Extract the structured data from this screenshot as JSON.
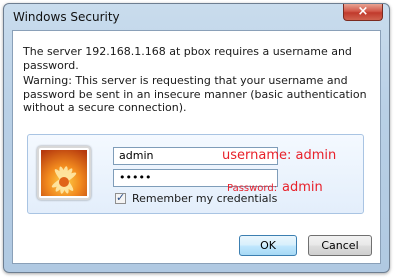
{
  "window": {
    "title": "Windows Security",
    "close_label": "×"
  },
  "message": {
    "server_line": "The server 192.168.1.168 at pbox requires a username and password.",
    "warning": "Warning: This server is requesting that your username and password be sent in an insecure manner (basic authentication without a secure connection)."
  },
  "credentials": {
    "username_value": "admin",
    "password_value": "•••••",
    "remember_label": "Remember my credentials",
    "remember_checked": true,
    "remember_mark": "✓"
  },
  "annotations": {
    "username": "username: admin",
    "password_label": "Password:",
    "password_value": "admin",
    "color": "#e8202a"
  },
  "buttons": {
    "ok": "OK",
    "cancel": "Cancel"
  },
  "icons": {
    "avatar": "user-avatar-flower-icon",
    "close": "close-icon",
    "checkbox": "checkmark-icon"
  }
}
